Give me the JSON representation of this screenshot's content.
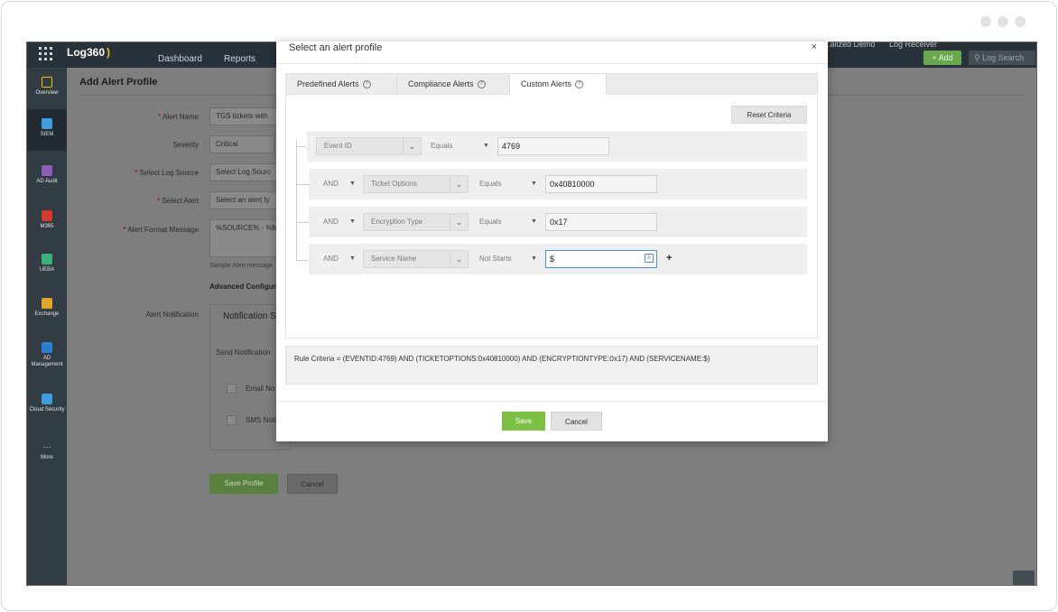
{
  "app": {
    "logo": "Log360",
    "nav": [
      "Dashboard",
      "Reports"
    ],
    "top_right": [
      "...alized Demo",
      "Log Receiver"
    ],
    "add_label": "Add",
    "log_search_label": "Log Search"
  },
  "sidebar": {
    "items": [
      {
        "label": "Overview",
        "icon": "grid-icon"
      },
      {
        "label": "SIEM",
        "icon": "shield-icon"
      },
      {
        "label": "AD Audit",
        "icon": "search-icon"
      },
      {
        "label": "M365",
        "icon": "office-icon"
      },
      {
        "label": "UEBA",
        "icon": "eye-icon"
      },
      {
        "label": "Exchange",
        "icon": "mail-icon"
      },
      {
        "label": "AD Management",
        "icon": "user-tree-icon"
      },
      {
        "label": "Cloud Security",
        "icon": "cloud-icon"
      },
      {
        "label": "More",
        "icon": "more-icon"
      }
    ]
  },
  "page": {
    "title": "Add Alert Profile",
    "fields": {
      "alert_name_label": "Alert Name",
      "alert_name_value": "TGS tickets with",
      "severity_label": "Severity",
      "severity_value": "Critical",
      "log_source_label": "Select Log Source",
      "log_source_placeholder": "Select Log Sourc",
      "select_alert_label": "Select Alert",
      "select_alert_placeholder": "Select an alert ty",
      "format_message_label": "Alert Format Message",
      "format_message_value": "%SOURCE% - %M",
      "sample_note": "Sample Alert message",
      "advanced_config": "Advanced Configur",
      "notification_label": "Alert Notification",
      "notification_settings": "Notification S",
      "send_notification": "Send Notification",
      "email_notification": "Email No",
      "sms_notification": "SMS Noti"
    },
    "save_profile": "Save Profile",
    "cancel": "Cancel"
  },
  "modal": {
    "title": "Select an alert profile",
    "close": "×",
    "tabs": [
      {
        "label": "Predefined Alerts",
        "active": false
      },
      {
        "label": "Compliance Alerts",
        "active": false
      },
      {
        "label": "Custom Alerts",
        "active": true
      }
    ],
    "reset_criteria": "Reset Criteria",
    "criteria": [
      {
        "connector": "",
        "field": "Event ID",
        "operator": "Equals",
        "value": "4769"
      },
      {
        "connector": "AND",
        "field": "Ticket Options",
        "operator": "Equals",
        "value": "0x40810000"
      },
      {
        "connector": "AND",
        "field": "Encryption Type",
        "operator": "Equals",
        "value": "0x17"
      },
      {
        "connector": "AND",
        "field": "Service Name",
        "operator": "Not Starts",
        "value": "$"
      }
    ],
    "rule_criteria": "Rule Criteria = (EVENTID:4769) AND (TICKETOPTIONS:0x40810000) AND (ENCRYPTIONTYPE:0x17) AND (SERVICENAME:$)",
    "save": "Save",
    "cancel": "Cancel"
  },
  "colors": {
    "accent_green": "#7cc143",
    "topbar": "#27323a",
    "sidebar": "#323c43"
  }
}
